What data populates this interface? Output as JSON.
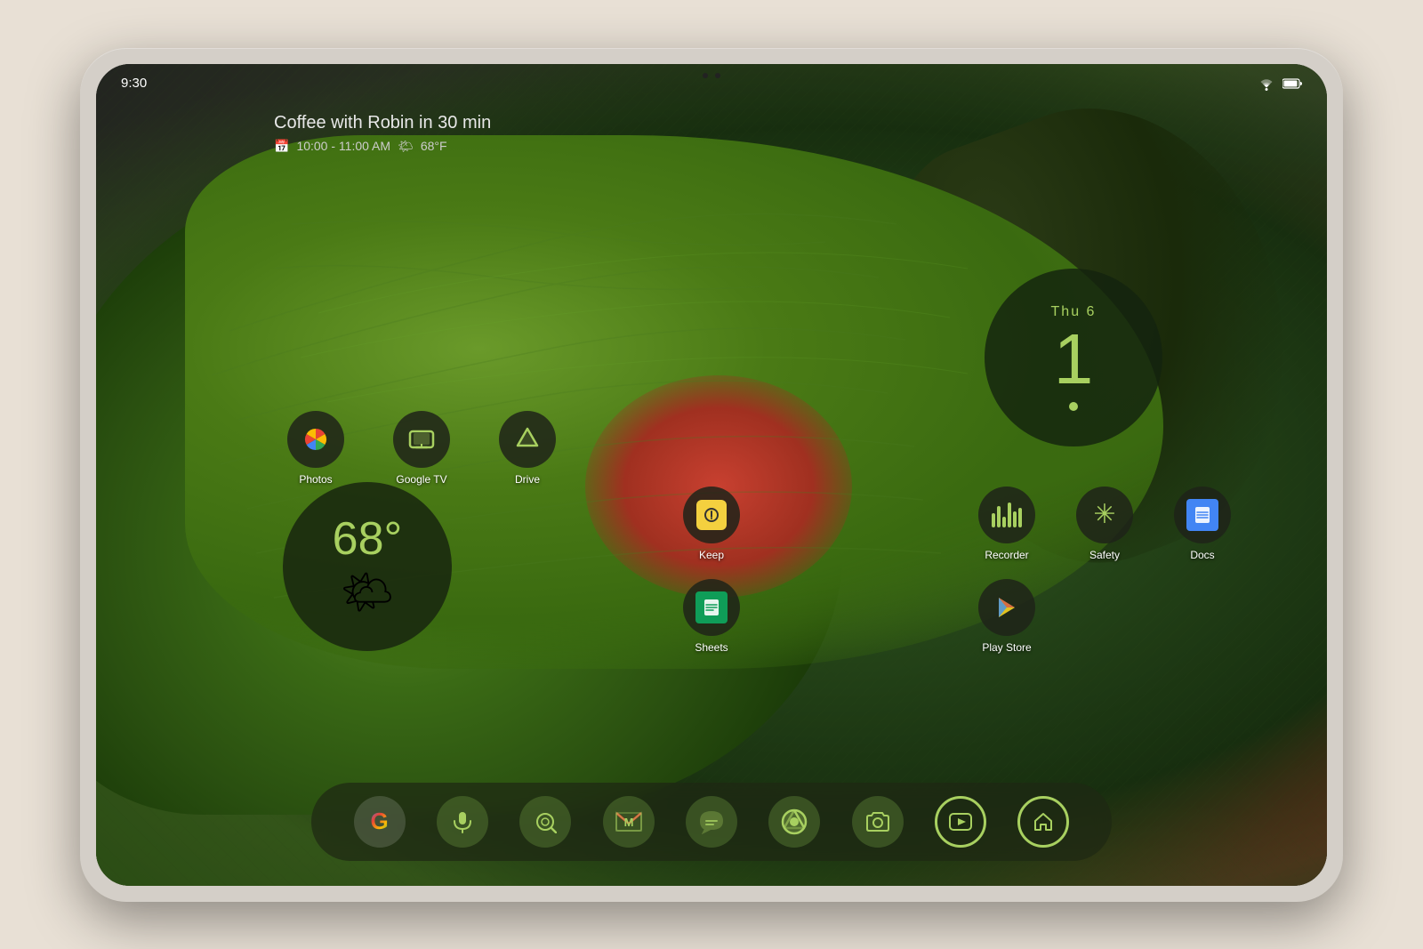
{
  "device": {
    "type": "Android tablet",
    "model": "Pixel Tablet"
  },
  "status_bar": {
    "time": "9:30",
    "wifi": "▼",
    "battery": "▮"
  },
  "calendar_widget": {
    "event_title": "Coffee with Robin in 30 min",
    "event_time": "10:00 - 11:00 AM",
    "event_weather": "68°F",
    "calendar_icon": "📅",
    "weather_icon": "🌤"
  },
  "weather_widget": {
    "temperature": "68°",
    "icon": "🌤"
  },
  "clock_widget": {
    "day": "Thu 6",
    "hour": "1"
  },
  "apps_middle_row": [
    {
      "id": "photos",
      "label": "Photos",
      "icon": "pinwheel"
    },
    {
      "id": "google-tv",
      "label": "Google TV",
      "icon": "tv"
    },
    {
      "id": "drive",
      "label": "Drive",
      "icon": "drive"
    }
  ],
  "apps_center_col": [
    {
      "id": "keep",
      "label": "Keep",
      "icon": "lightbulb"
    },
    {
      "id": "sheets",
      "label": "Sheets",
      "icon": "sheets"
    }
  ],
  "apps_right_grid": [
    {
      "id": "recorder",
      "label": "Recorder",
      "icon": "bars"
    },
    {
      "id": "safety",
      "label": "Safety",
      "icon": "asterisk"
    },
    {
      "id": "docs",
      "label": "Docs",
      "icon": "docs"
    },
    {
      "id": "play-store",
      "label": "Play Store",
      "icon": "play"
    }
  ],
  "dock": {
    "apps": [
      {
        "id": "google-search",
        "label": "Google",
        "icon": "G"
      },
      {
        "id": "assistant",
        "label": "Mic",
        "icon": "mic"
      },
      {
        "id": "lens",
        "label": "Lens",
        "icon": "camera"
      },
      {
        "id": "gmail",
        "label": "Gmail",
        "icon": "M"
      },
      {
        "id": "messages",
        "label": "Messages",
        "icon": "chat"
      },
      {
        "id": "chrome",
        "label": "Chrome",
        "icon": "chrome"
      },
      {
        "id": "camera",
        "label": "Camera",
        "icon": "cam"
      },
      {
        "id": "youtube",
        "label": "YouTube",
        "icon": "yt"
      },
      {
        "id": "pixel-launcher",
        "label": "Pixel Launcher",
        "icon": "home"
      }
    ]
  }
}
